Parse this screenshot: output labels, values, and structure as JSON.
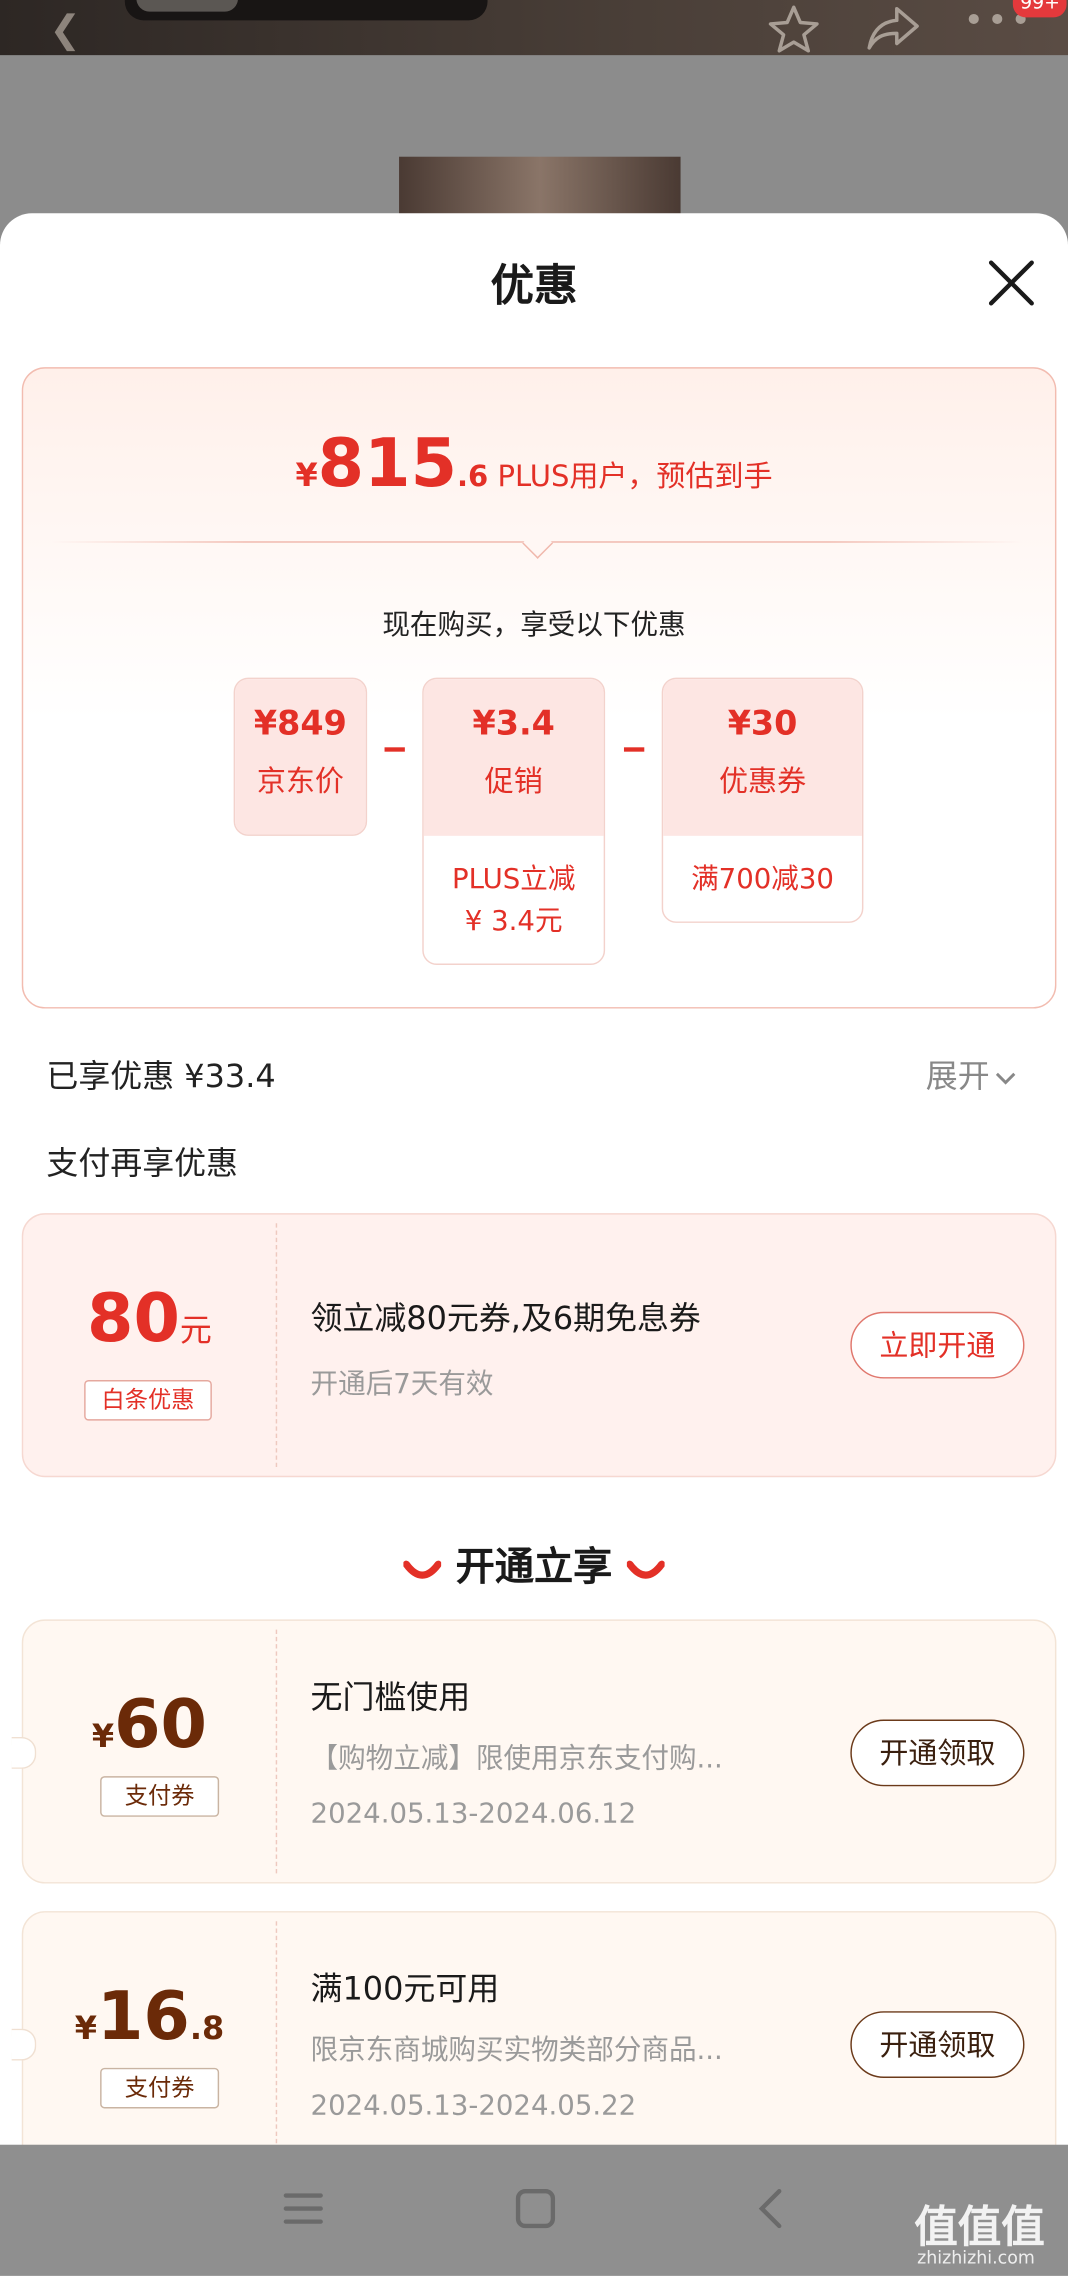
{
  "header": {
    "badge": "99+"
  },
  "sheet": {
    "title": "优惠"
  },
  "summary": {
    "currency": "¥",
    "price_int": "815",
    "price_dec": ".6",
    "note": " PLUS用户，预估到手",
    "subtitle": "现在购买，享受以下优惠",
    "items": [
      {
        "amount": "¥849",
        "label": "京东价",
        "detail": ""
      },
      {
        "amount": "¥3.4",
        "label": "促销",
        "detail": "PLUS立减\n¥ 3.4元"
      },
      {
        "amount": "¥30",
        "label": "优惠券",
        "detail": "满700减30"
      }
    ]
  },
  "enjoyed": {
    "text": "已享优惠 ¥33.4",
    "expand_label": "展开"
  },
  "pay_section": {
    "title": "支付再享优惠"
  },
  "baitiao": {
    "amount": "80",
    "unit": "元",
    "tag": "白条优惠",
    "title": "领立减80元券,及6期免息券",
    "subtitle": "开通后7天有效",
    "button": "立即开通"
  },
  "instant": {
    "title": "开通立享"
  },
  "coupons": [
    {
      "currency": "¥",
      "amount_int": "60",
      "amount_dec": "",
      "tag": "支付券",
      "title": "无门槛使用",
      "desc": "【购物立减】限使用京东支付购...",
      "date": "2024.05.13-2024.06.12",
      "button": "开通领取"
    },
    {
      "currency": "¥",
      "amount_int": "16",
      "amount_dec": ".8",
      "tag": "支付券",
      "title": "满100元可用",
      "desc": "限京东商城购买实物类部分商品...",
      "date": "2024.05.13-2024.05.22",
      "button": "开通领取"
    }
  ],
  "watermark": {
    "logo": "值值值",
    "url": "zhizhizhi.com"
  },
  "colors": {
    "accent": "#e33027",
    "coupon_brown": "#6b2a08"
  }
}
